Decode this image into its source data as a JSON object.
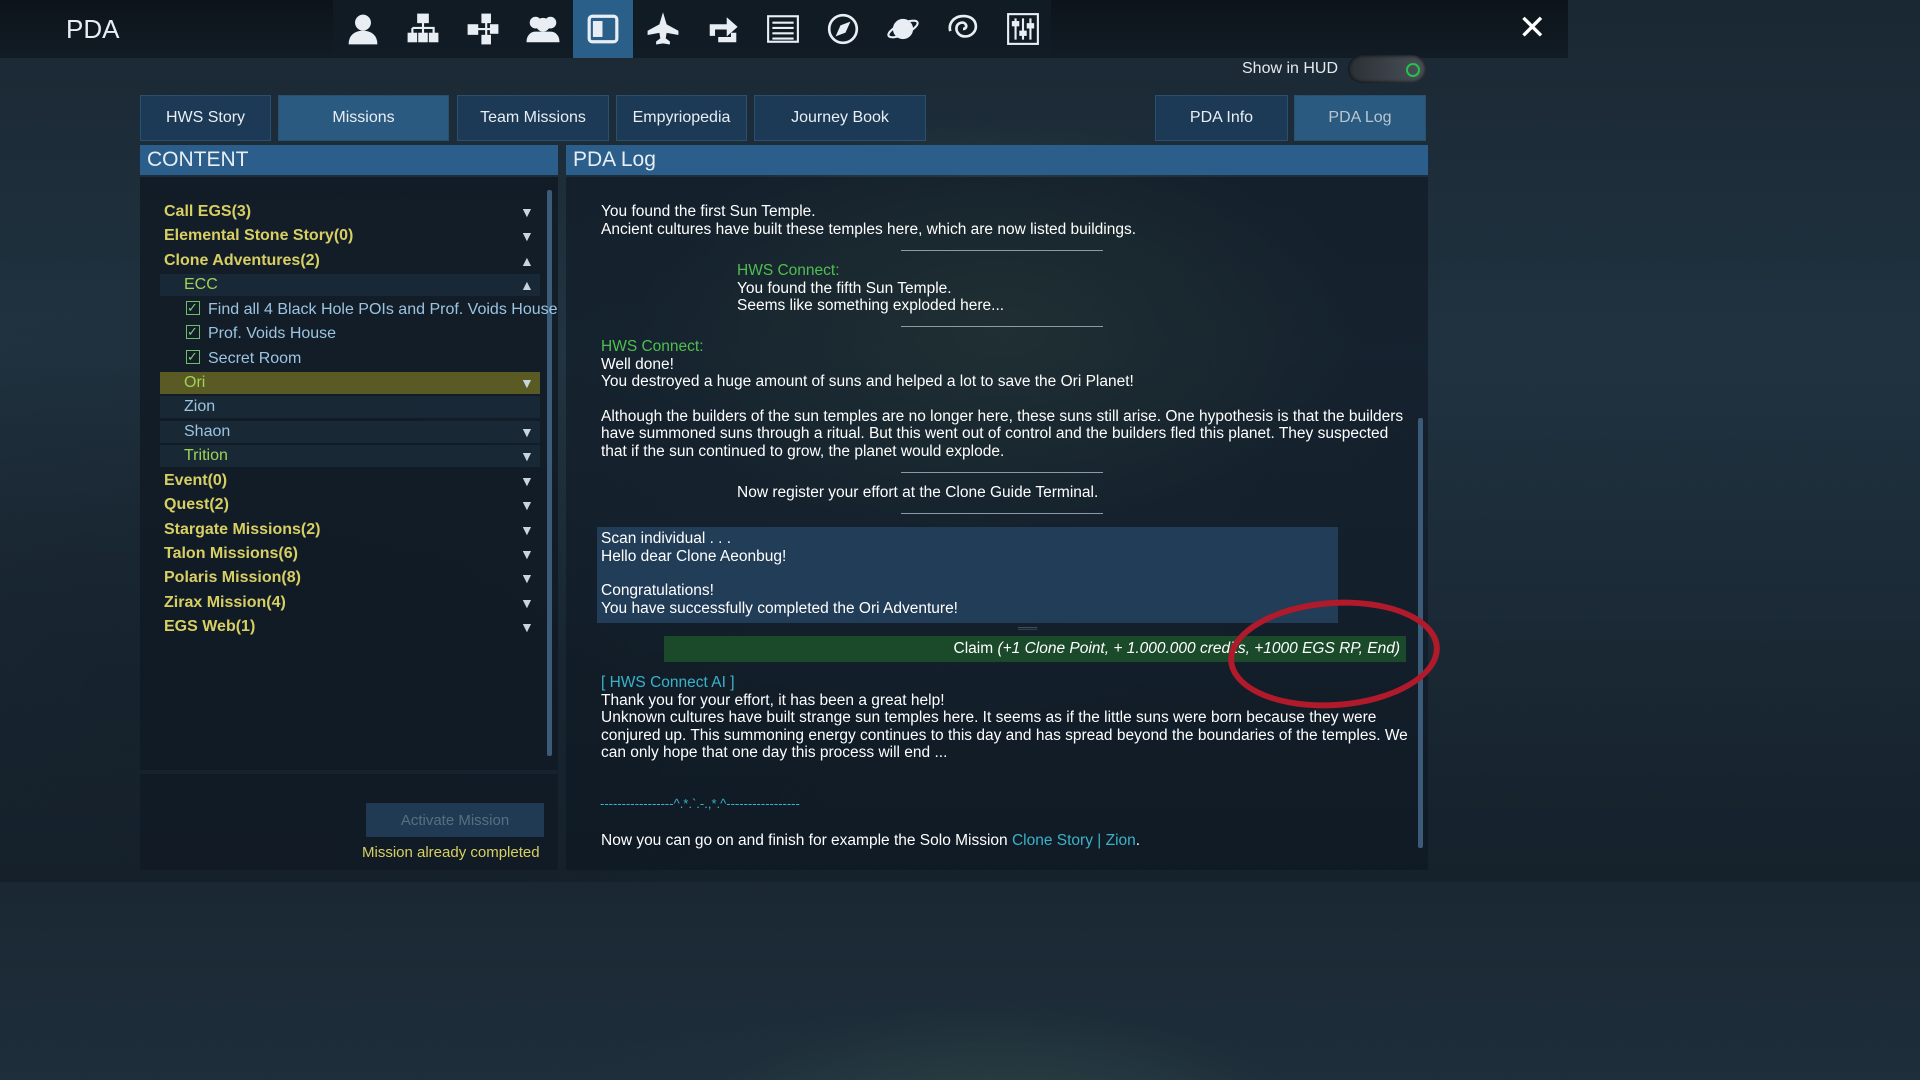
{
  "app": {
    "title": "PDA",
    "close_label": "✕"
  },
  "toolbar": {
    "icons": [
      "person-icon",
      "network-icon",
      "hierarchy-icon",
      "group-icon",
      "pda-log-icon",
      "ship-icon",
      "trade-icon",
      "list-icon",
      "compass-icon",
      "planet-icon",
      "galaxy-icon",
      "settings-sliders-icon"
    ],
    "active_index": 4
  },
  "hud": {
    "label": "Show in HUD",
    "enabled": true
  },
  "tabs": {
    "left": [
      "HWS Story",
      "Missions",
      "Team Missions",
      "Empyriopedia",
      "Journey Book"
    ],
    "right": [
      "PDA Info",
      "PDA Log"
    ],
    "active_left": "Missions",
    "active_right": "PDA Log"
  },
  "content": {
    "header": "CONTENT",
    "items": [
      {
        "label": "Call EGS(3)",
        "arrow": "▼"
      },
      {
        "label": "Elemental Stone Story(0)",
        "arrow": "▼"
      },
      {
        "label": "Clone Adventures(2)",
        "arrow": "▲"
      },
      {
        "label": "ECC",
        "arrow": "▲"
      },
      {
        "label": "Find all 4 Black Hole POIs and Prof. Voids House"
      },
      {
        "label": "Prof. Voids House"
      },
      {
        "label": "Secret Room"
      },
      {
        "label": "Ori",
        "arrow": "▼"
      },
      {
        "label": "Zion"
      },
      {
        "label": "Shaon",
        "arrow": "▼"
      },
      {
        "label": "Trition",
        "arrow": "▼"
      },
      {
        "label": "Event(0)",
        "arrow": "▼"
      },
      {
        "label": "Quest(2)",
        "arrow": "▼"
      },
      {
        "label": "Stargate Missions(2)",
        "arrow": "▼"
      },
      {
        "label": "Talon Missions(6)",
        "arrow": "▼"
      },
      {
        "label": "Polaris Mission(8)",
        "arrow": "▼"
      },
      {
        "label": "Zirax Mission(4)",
        "arrow": "▼"
      },
      {
        "label": "EGS Web(1)",
        "arrow": "▼"
      }
    ],
    "activate_label": "Activate Mission",
    "status": "Mission already completed"
  },
  "log": {
    "header": "PDA Log",
    "hws_label": "HWS Connect:",
    "entry1_line1": "You found the first Sun Temple.",
    "entry1_line2": "Ancient cultures have built these temples here, which are now listed buildings.",
    "entry2_line1": "You found the fifth Sun Temple.",
    "entry2_line2": "Seems like something exploded here...",
    "entry3_line1": "Well done!",
    "entry3_line2": "You destroyed a huge amount of suns and helped a lot to save the Ori Planet!",
    "entry3_p2_l1": "Although the builders of the sun temples are no longer here, these suns still arise. One hypothesis is that the builders",
    "entry3_p2_l2": "have summoned suns through a ritual. But this went out of control and the builders fled this planet. They suspected",
    "entry3_p2_l3": "that if the sun continued to grow, the planet would explode.",
    "register": "Now register your effort at the Clone Guide Terminal.",
    "scan_l1": "Scan individual . . .",
    "scan_l2": "Hello dear Clone Aeonbug!",
    "scan_l3": "Congratulations!",
    "scan_l4": "You have successfully completed the Ori Adventure!",
    "claim_prefix": "Claim ",
    "claim_detail": "(+1 Clone Point, + 1.000.000 credits, +1000 EGS RP, End)",
    "ai_head": "[ HWS Connect AI ]",
    "ai_l1": "Thank you for your effort, it has been a great help!",
    "ai_l2": "Unknown cultures have built strange sun temples here. It seems as if the little suns were born because they were",
    "ai_l3": "conjured up. This summoning energy continues to this day and has spread beyond the boundaries of the temples. We",
    "ai_l4": "can only hope that one day this process will end ...",
    "deco": "-----------------^.*.`.-.,*.^-----------------",
    "final_prefix": "Now you can go on and finish for example the Solo Mission ",
    "final_link": "Clone Story | Zion",
    "final_suffix": "."
  },
  "colors": {
    "accent": "#2b5e8b",
    "category": "#d8cf63",
    "hws_green": "#4fbf4f",
    "link": "#39b3c9",
    "annotation": "#b01a2a"
  }
}
